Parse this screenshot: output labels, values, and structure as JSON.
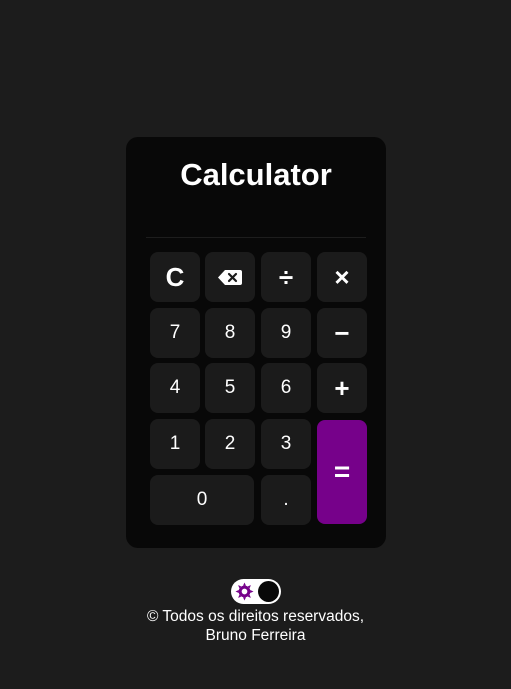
{
  "calculator": {
    "title": "Calculator",
    "display_value": ""
  },
  "keys": {
    "clear": "C",
    "divide": "÷",
    "multiply": "×",
    "seven": "7",
    "eight": "8",
    "nine": "9",
    "subtract": "−",
    "four": "4",
    "five": "5",
    "six": "6",
    "add": "+",
    "one": "1",
    "two": "2",
    "three": "3",
    "equals": "=",
    "zero": "0",
    "decimal": "."
  },
  "theme_toggle": {
    "icon": "sun-icon",
    "state": "dark"
  },
  "footer": {
    "line1": "© Todos os direitos reservados,",
    "line2": "Bruno Ferreira"
  },
  "colors": {
    "background": "#1c1c1c",
    "calculator_body": "#080808",
    "key": "#1b1b1b",
    "accent": "#76018a",
    "text": "#ffffff"
  }
}
